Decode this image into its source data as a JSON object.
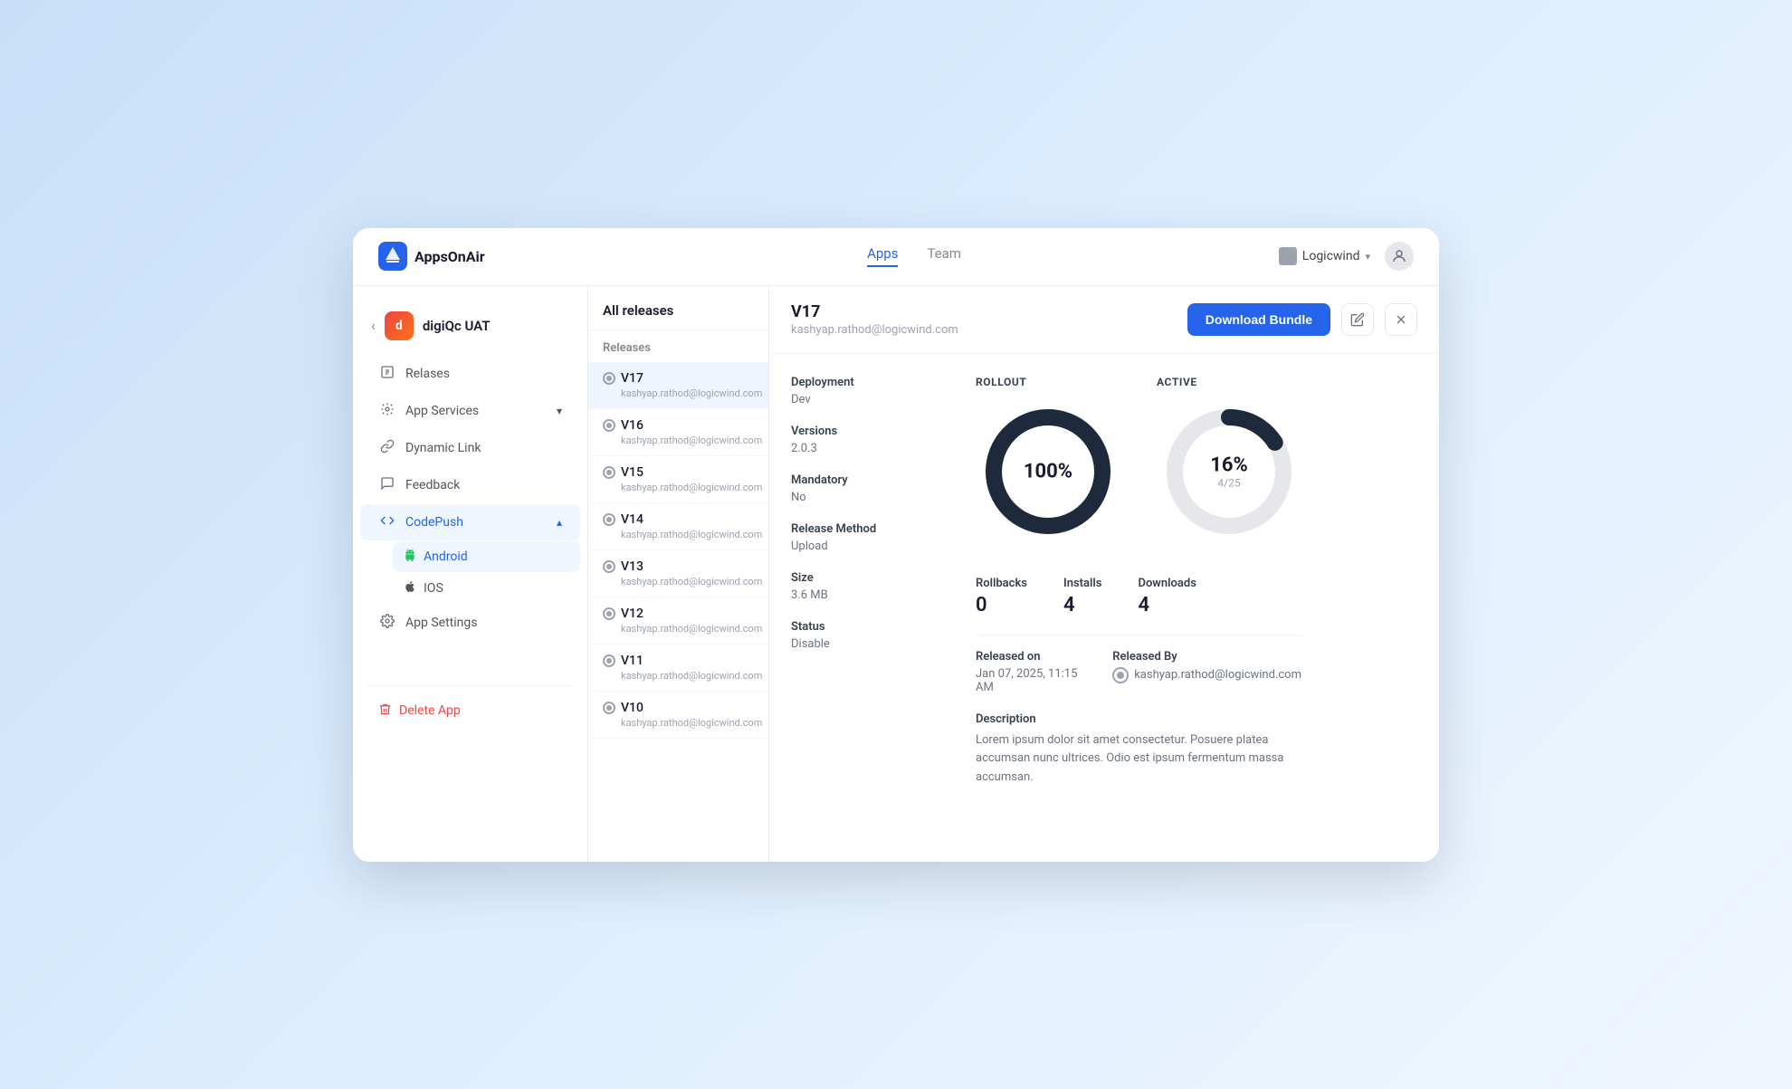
{
  "header": {
    "logo_text": "AppsOnAir",
    "nav_tabs": [
      {
        "label": "Apps",
        "active": true
      },
      {
        "label": "Team",
        "active": false
      }
    ],
    "org_name": "Logicwind",
    "user_icon_label": "user"
  },
  "sidebar": {
    "back_label": "‹",
    "app_name": "digiQc UAT",
    "items": [
      {
        "label": "Relases",
        "icon": "📋",
        "active": false
      },
      {
        "label": "App Services",
        "icon": "⚙️",
        "active": false,
        "has_arrow": true
      },
      {
        "label": "Dynamic Link",
        "icon": "🔗",
        "active": false
      },
      {
        "label": "Feedback",
        "icon": "💬",
        "active": false
      },
      {
        "label": "CodePush",
        "icon": "<>",
        "active": true,
        "has_arrow": true
      },
      {
        "label": "App Settings",
        "icon": "⚙️",
        "active": false
      }
    ],
    "sub_items": [
      {
        "label": "Android",
        "icon": "🤖",
        "active": true
      },
      {
        "label": "IOS",
        "icon": "🍎",
        "active": false
      }
    ],
    "delete_label": "Delete App"
  },
  "release_list": {
    "panel_title": "All releases",
    "releases_section_label": "Releases",
    "items": [
      {
        "version": "V17",
        "email": "kashyap.rathod@logicwind.com",
        "active": true
      },
      {
        "version": "V16",
        "email": "kashyap.rathod@logicwind.com",
        "active": false
      },
      {
        "version": "V15",
        "email": "kashyap.rathod@logicwind.com",
        "active": false
      },
      {
        "version": "V14",
        "email": "kashyap.rathod@logicwind.com",
        "active": false
      },
      {
        "version": "V13",
        "email": "kashyap.rathod@logicwind.com",
        "active": false
      },
      {
        "version": "V12",
        "email": "kashyap.rathod@logicwind.com",
        "active": false
      },
      {
        "version": "V11",
        "email": "kashyap.rathod@logicwind.com",
        "active": false
      },
      {
        "version": "V10",
        "email": "kashyap.rathod@logicwind.com",
        "active": false
      }
    ]
  },
  "detail": {
    "version": "V17",
    "email": "kashyap.rathod@logicwind.com",
    "download_btn_label": "Download Bundle",
    "meta": {
      "deployment_label": "Deployment",
      "deployment_value": "Dev",
      "versions_label": "Versions",
      "versions_value": "2.0.3",
      "mandatory_label": "Mandatory",
      "mandatory_value": "No",
      "release_method_label": "Release Method",
      "release_method_value": "Upload",
      "size_label": "Size",
      "size_value": "3.6 MB",
      "status_label": "Status",
      "status_value": "Disable"
    },
    "rollout": {
      "title": "ROLLOUT",
      "percent": 100,
      "percent_label": "100%"
    },
    "active_chart": {
      "title": "ACTIVE",
      "percent": 16,
      "percent_label": "16%",
      "sub_label": "4/25"
    },
    "stats": {
      "rollbacks_label": "Rollbacks",
      "rollbacks_value": "0",
      "installs_label": "Installs",
      "installs_value": "4",
      "downloads_label": "Downloads",
      "downloads_value": "4"
    },
    "released_on_label": "Released on",
    "released_on_value": "Jan 07, 2025, 11:15 AM",
    "released_by_label": "Released By",
    "released_by_value": "kashyap.rathod@logicwind.com",
    "description_label": "Description",
    "description_value": "Lorem ipsum dolor sit amet consectetur. Posuere platea accumsan nunc ultrices. Odio est ipsum fermentum massa accumsan."
  }
}
